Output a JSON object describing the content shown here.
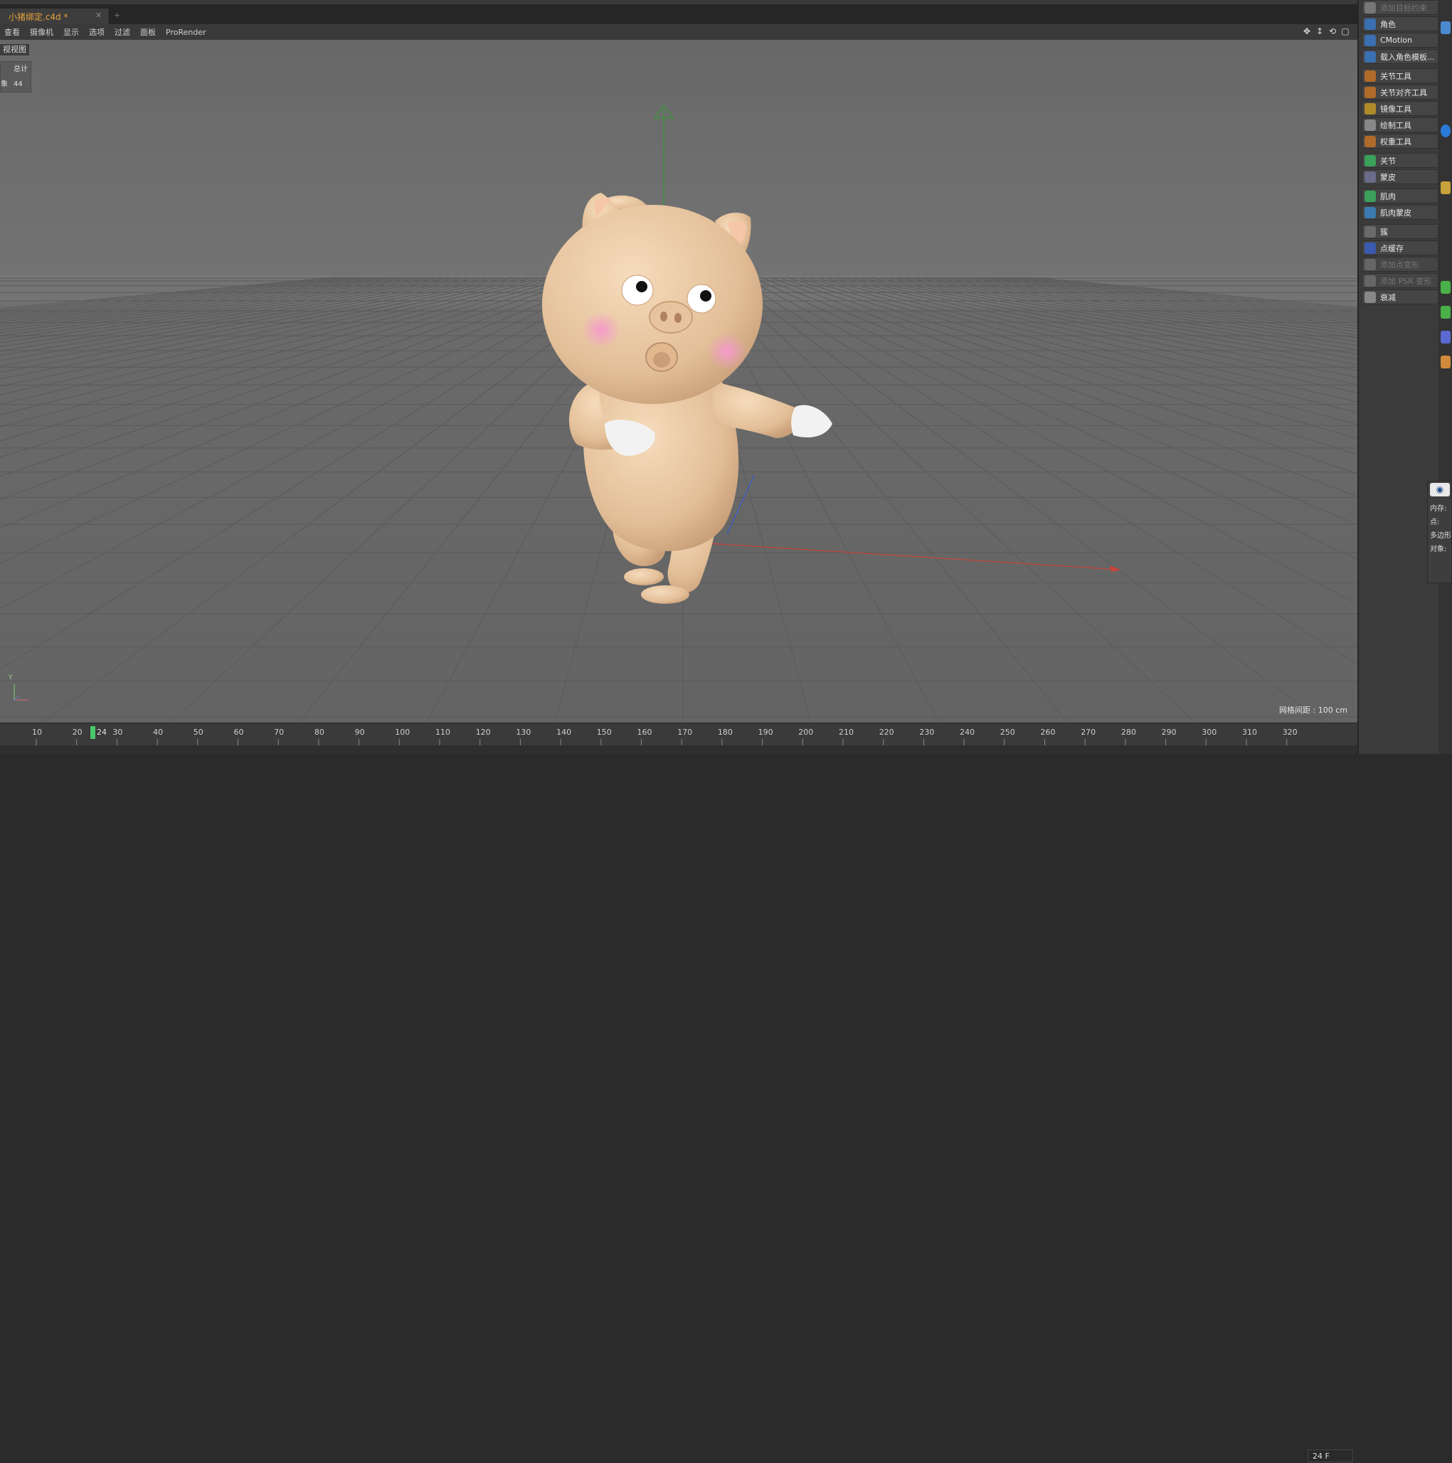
{
  "tab": {
    "title": "小猪绑定.c4d *",
    "close": "✕",
    "new": "+"
  },
  "menu": [
    "查看",
    "摄像机",
    "显示",
    "选项",
    "过滤",
    "面板",
    "ProRender"
  ],
  "viewport": {
    "label": "视视图",
    "stats": {
      "total_label": "总计",
      "object_label": "象",
      "object_count": "44"
    },
    "grid_spacing": "网格间距 : 100 cm",
    "axis_label": "Y"
  },
  "timeline": {
    "current_frame": "24",
    "ticks": [
      "10",
      "20",
      "30",
      "40",
      "50",
      "60",
      "70",
      "80",
      "90",
      "100",
      "110",
      "120",
      "130",
      "140",
      "150",
      "160",
      "170",
      "180",
      "190",
      "200",
      "210",
      "220",
      "230",
      "240",
      "250",
      "260",
      "270",
      "280",
      "290",
      "300",
      "310",
      "320"
    ],
    "fps": "24 F"
  },
  "palette": {
    "items": [
      {
        "label": "添加目标约束",
        "icon": "constraint-icon",
        "color": "#777777",
        "disabled": true
      },
      {
        "label": "角色",
        "icon": "character-icon",
        "color": "#3a6fb0",
        "disabled": false
      },
      {
        "label": "CMotion",
        "icon": "cmotion-icon",
        "color": "#3a6fb0",
        "disabled": false
      },
      {
        "label": "载入角色模板...",
        "icon": "load-template-icon",
        "color": "#3a6fb0",
        "disabled": false
      },
      {
        "label": "关节工具",
        "icon": "joint-tool-icon",
        "color": "#b06a2a",
        "disabled": false
      },
      {
        "label": "关节对齐工具",
        "icon": "joint-align-icon",
        "color": "#b06a2a",
        "disabled": false
      },
      {
        "label": "镜像工具",
        "icon": "mirror-tool-icon",
        "color": "#b08a2a",
        "disabled": false
      },
      {
        "label": "绘制工具",
        "icon": "paint-tool-icon",
        "color": "#888888",
        "disabled": false
      },
      {
        "label": "权重工具",
        "icon": "weight-tool-icon",
        "color": "#b06a2a",
        "disabled": false
      },
      {
        "label": "关节",
        "icon": "joint-icon",
        "color": "#3aa05a",
        "disabled": false
      },
      {
        "label": "蒙皮",
        "icon": "skin-icon",
        "color": "#6a6a8a",
        "disabled": false
      },
      {
        "label": "肌肉",
        "icon": "muscle-icon",
        "color": "#3aa05a",
        "disabled": false
      },
      {
        "label": "肌肉蒙皮",
        "icon": "muscle-skin-icon",
        "color": "#3a7ab0",
        "disabled": false
      },
      {
        "label": "簇",
        "icon": "cluster-icon",
        "color": "#6a6a6a",
        "disabled": false
      },
      {
        "label": "点缓存",
        "icon": "point-cache-icon",
        "color": "#3a5ab0",
        "disabled": false
      },
      {
        "label": "添加点变形",
        "icon": "add-point-morph-icon",
        "color": "#666666",
        "disabled": true
      },
      {
        "label": "添加 PSR 变形",
        "icon": "add-psr-morph-icon",
        "color": "#666666",
        "disabled": true
      },
      {
        "label": "衰减",
        "icon": "falloff-icon",
        "color": "#888888",
        "disabled": false
      }
    ]
  },
  "info": {
    "rows": [
      "内存:",
      "点:",
      "多边形",
      "对象:"
    ],
    "eye": "◉"
  },
  "colors": {
    "accent": "#e8a23a",
    "x_axis": "#d23a3a",
    "y_axis": "#3aa03a",
    "z_axis": "#3a5ad2",
    "skin": "#e8c49e"
  }
}
